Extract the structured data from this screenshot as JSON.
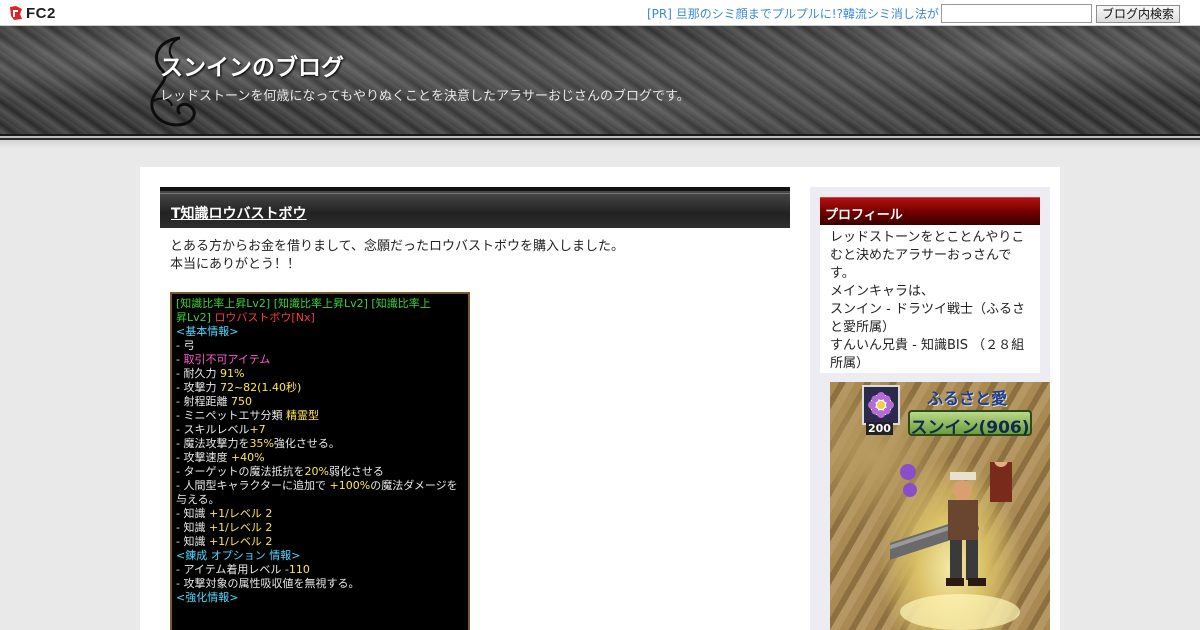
{
  "topbar": {
    "logo_text": "FC2",
    "pr_link": "[PR] 旦那のシミ顔までプルプルに!?韓流シミ消し法が",
    "search_button": "ブログ内検索",
    "search_value": ""
  },
  "header": {
    "title": "スンインのブログ",
    "description": "レッドストーンを何歳になってもやりぬくことを決意したアラサーおじさんのブログです。"
  },
  "entry": {
    "title": "T知識ロウバストボウ",
    "body_lines": [
      "とある方からお金を借りまして、念願だったロウバストボウを購入しました。",
      "本当にありがとう！！"
    ]
  },
  "item": {
    "lines": [
      {
        "segments": [
          {
            "text": "[知識比率上昇Lv2] [知識比率上昇Lv2] [知識比率上",
            "color": "green"
          }
        ]
      },
      {
        "segments": [
          {
            "text": "昇Lv2] ",
            "color": "green"
          },
          {
            "text": "ロウバストボウ[Nx]",
            "color": "red"
          }
        ]
      },
      {
        "segments": [
          {
            "text": "<基本情報>",
            "color": "cyan"
          }
        ]
      },
      {
        "segments": [
          {
            "text": "- 弓",
            "color": "white"
          }
        ]
      },
      {
        "segments": [
          {
            "text": "- ",
            "color": "white"
          },
          {
            "text": "取引不可アイテム",
            "color": "pink"
          }
        ]
      },
      {
        "segments": [
          {
            "text": "- 耐久力 ",
            "color": "white"
          },
          {
            "text": "91%",
            "color": "yellow"
          }
        ]
      },
      {
        "segments": [
          {
            "text": "- 攻撃力 ",
            "color": "white"
          },
          {
            "text": "72~82(1.40秒)",
            "color": "yellow"
          }
        ]
      },
      {
        "segments": [
          {
            "text": "- 射程距離 ",
            "color": "white"
          },
          {
            "text": "750",
            "color": "yellow"
          }
        ]
      },
      {
        "segments": [
          {
            "text": "- ミニペットエサ分類 ",
            "color": "white"
          },
          {
            "text": "精霊型",
            "color": "yellow"
          }
        ]
      },
      {
        "segments": [
          {
            "text": "- スキルレベル",
            "color": "white"
          },
          {
            "text": "+7",
            "color": "yellow"
          }
        ]
      },
      {
        "segments": [
          {
            "text": "- 魔法攻撃力を",
            "color": "white"
          },
          {
            "text": "35%",
            "color": "yellow"
          },
          {
            "text": "強化させる。",
            "color": "white"
          }
        ]
      },
      {
        "segments": [
          {
            "text": "- 攻撃速度  ",
            "color": "white"
          },
          {
            "text": "+40%",
            "color": "yellow"
          }
        ]
      },
      {
        "segments": [
          {
            "text": "- ターゲットの魔法抵抗を",
            "color": "white"
          },
          {
            "text": "20%",
            "color": "yellow"
          },
          {
            "text": "弱化させる",
            "color": "white"
          }
        ]
      },
      {
        "segments": [
          {
            "text": "- 人間型キャラクターに追加で ",
            "color": "white"
          },
          {
            "text": "+100%",
            "color": "yellow"
          },
          {
            "text": "の魔法ダメージを",
            "color": "white"
          }
        ]
      },
      {
        "segments": [
          {
            "text": "与える。",
            "color": "white"
          }
        ]
      },
      {
        "segments": [
          {
            "text": "- 知識 ",
            "color": "white"
          },
          {
            "text": "+1/レベル 2",
            "color": "yellow"
          }
        ]
      },
      {
        "segments": [
          {
            "text": "- 知識 ",
            "color": "white"
          },
          {
            "text": "+1/レベル 2",
            "color": "yellow"
          }
        ]
      },
      {
        "segments": [
          {
            "text": "- 知識 ",
            "color": "white"
          },
          {
            "text": "+1/レベル 2",
            "color": "yellow"
          }
        ]
      },
      {
        "segments": [
          {
            "text": "<錬成 オプション 情報>",
            "color": "cyan"
          }
        ]
      },
      {
        "segments": [
          {
            "text": "- アイテム着用レベル ",
            "color": "white"
          },
          {
            "text": "-110",
            "color": "yellow"
          }
        ]
      },
      {
        "segments": [
          {
            "text": "- 攻撃対象の属性吸収値を無視する。",
            "color": "white"
          }
        ]
      },
      {
        "segments": [
          {
            "text": "<強化情報>",
            "color": "cyan"
          }
        ]
      }
    ]
  },
  "sidebar": {
    "profile_title": "プロフィール",
    "profile_lines": [
      "レッドストーンをとことんやりこむと決めたアラサーおっさんです。",
      "メインキャラは、",
      "スンイン - ドラツイ戦士（ふるさと愛所属）",
      "すんいん兄貴 - 知識BIS （２８組所属）"
    ],
    "game_image": {
      "guild_name": "ふるさと愛",
      "character_name": "スンイン(906)",
      "rank": "200"
    }
  },
  "colors": {
    "green": "#39d339",
    "red": "#ff3b3b",
    "cyan": "#4fd8ff",
    "pink": "#ff5ad2",
    "yellow": "#ffe64a",
    "white": "#e8e8e8",
    "accent_red": "#8b0000",
    "link_blue": "#3b8ad6"
  }
}
